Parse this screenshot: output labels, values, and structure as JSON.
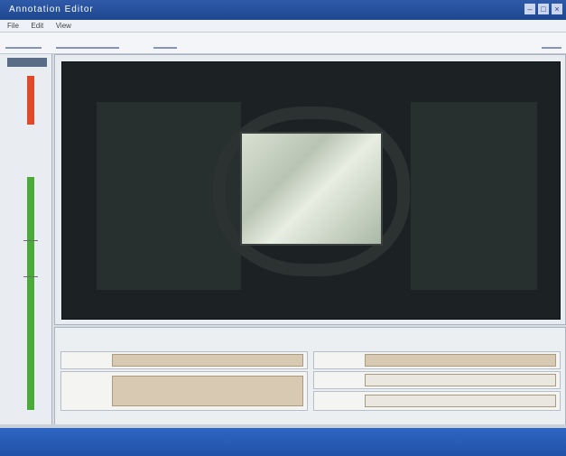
{
  "window": {
    "title": "Annotation Editor",
    "controls": [
      "–",
      "□",
      "×"
    ]
  },
  "menu": [
    "File",
    "Edit",
    "View"
  ],
  "toolbar": {
    "items": [
      "",
      "",
      "",
      ""
    ]
  },
  "left_pane": {
    "header": ""
  },
  "video": {
    "description_hidden": true
  },
  "form": {
    "left_rows": [
      {
        "label": ""
      },
      {
        "label": ""
      },
      {
        "label": ""
      }
    ],
    "right_rows": [
      {
        "label": ""
      },
      {
        "label": ""
      },
      {
        "label": ""
      }
    ]
  },
  "status": {
    "items": [
      "",
      "",
      "",
      "",
      "",
      "",
      "",
      ""
    ]
  }
}
